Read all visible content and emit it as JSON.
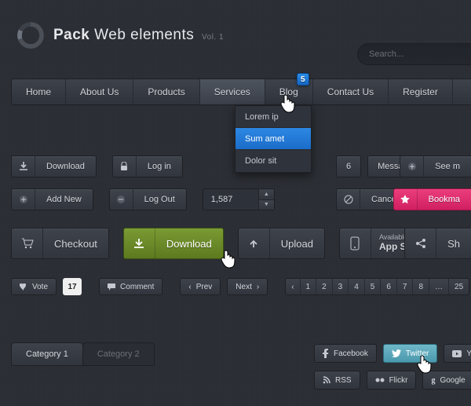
{
  "header": {
    "title_bold": "Pack",
    "title_rest": "Web elements",
    "vol": "Vol. 1",
    "search_placeholder": "Search..."
  },
  "nav": {
    "items": [
      "Home",
      "About Us",
      "Products",
      "Services",
      "Blog",
      "Contact Us",
      "Register"
    ],
    "active_index": 3,
    "blog_badge": "5"
  },
  "dropdown": {
    "items": [
      "Lorem ip",
      "Sum amet",
      "Dolor sit"
    ],
    "selected_index": 1
  },
  "row1": {
    "download": "Download",
    "login": "Log in",
    "msg_count": "6",
    "messages": "Messages",
    "see": "See m"
  },
  "row2": {
    "addnew": "Add New",
    "logout": "Log Out",
    "spinner": "1,587",
    "cancel": "Cancel",
    "bookmark": "Bookma"
  },
  "row3": {
    "checkout": "Checkout",
    "download": "Download",
    "upload": "Upload",
    "appstore_sub": "Available in the",
    "appstore_main": "App Store",
    "share": "Sh"
  },
  "row4": {
    "vote": "Vote",
    "vote_count": "17",
    "comment": "Comment",
    "prev": "Prev",
    "next": "Next",
    "pages": [
      "1",
      "2",
      "3",
      "4",
      "5",
      "6",
      "7",
      "8"
    ],
    "pages_last": "25"
  },
  "tabs": {
    "items": [
      "Category 1",
      "Category 2"
    ],
    "active_index": 0
  },
  "social": {
    "facebook": "Facebook",
    "twitter": "Twitter",
    "youtube": "Youtu",
    "rss": "RSS",
    "flickr": "Flickr",
    "google": "Google"
  },
  "colors": {
    "accent_blue": "#1f77d0",
    "pink": "#e2286b",
    "green": "#6c8f28",
    "twitter": "#5aa8bb"
  }
}
